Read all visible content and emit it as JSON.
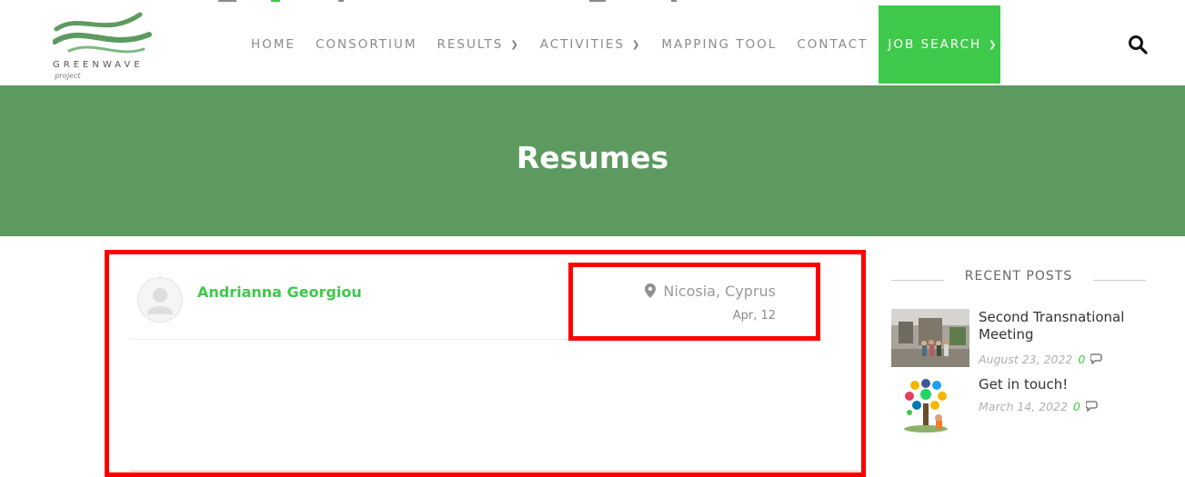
{
  "logo": {
    "name": "GREENWAVE",
    "sub": "project"
  },
  "nav": {
    "items": [
      {
        "label": "HOME",
        "dropdown": false
      },
      {
        "label": "CONSORTIUM",
        "dropdown": false
      },
      {
        "label": "RESULTS",
        "dropdown": true
      },
      {
        "label": "ACTIVITIES",
        "dropdown": true
      },
      {
        "label": "MAPPING TOOL",
        "dropdown": false
      },
      {
        "label": "CONTACT",
        "dropdown": false
      },
      {
        "label": "JOB SEARCH",
        "dropdown": true,
        "active": true
      }
    ],
    "search_icon": "search-icon"
  },
  "banner": {
    "title": "Resumes"
  },
  "resume": {
    "name": "Andrianna Georgiou",
    "location": "Nicosia, Cyprus",
    "date": "Apr, 12",
    "avatar_icon": "user-placeholder-icon",
    "location_icon": "map-pin-icon"
  },
  "sidebar": {
    "title": "RECENT POSTS",
    "posts": [
      {
        "title": "Second Transnational Meeting",
        "date": "August 23, 2022",
        "comments": "0"
      },
      {
        "title": "Get in touch!",
        "date": "March 14, 2022",
        "comments": "0"
      }
    ],
    "comment_icon": "comment-icon"
  },
  "colors": {
    "accent": "#3fc94a",
    "banner": "#5d9a60",
    "highlight": "#ff0000"
  }
}
